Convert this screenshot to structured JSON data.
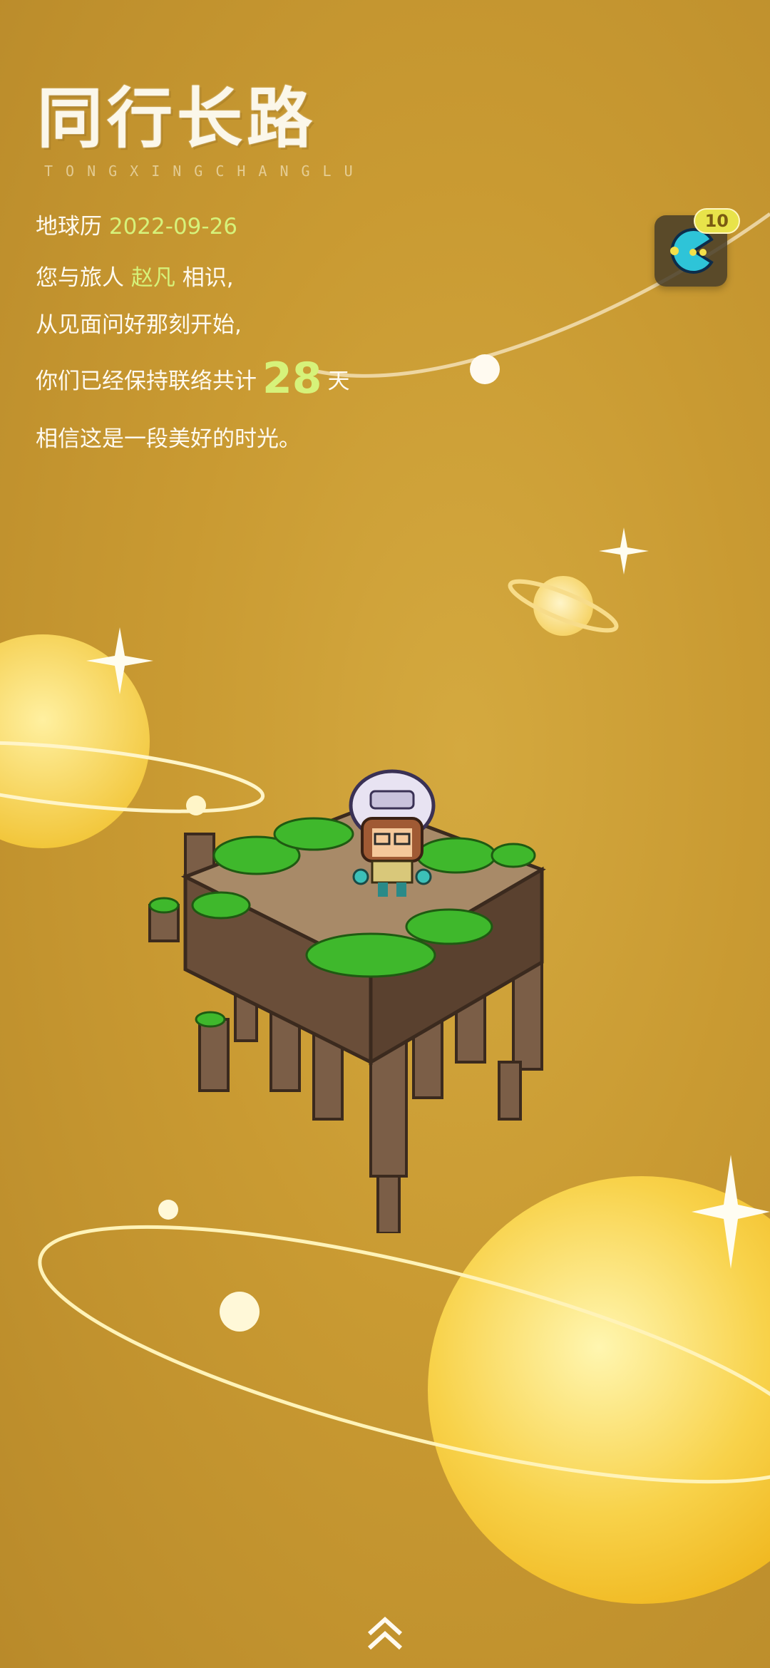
{
  "header": {
    "title": "同行长路",
    "subtitle": "TONGXINGCHANGLU"
  },
  "intro": {
    "date_label": "地球历",
    "date": "2022-09-26",
    "line2_prefix": "您与旅人",
    "traveler_name": "赵凡",
    "line2_suffix": "相识,",
    "line3": "从见面问好那刻开始,",
    "line4_prefix": "你们已经保持联络共计",
    "days": "28",
    "line4_suffix": "天",
    "line5": "相信这是一段美好的时光。"
  },
  "game_button": {
    "icon": "pacman-icon",
    "badge": "10"
  },
  "footer": {
    "scroll_icon": "double-chevron-up-icon"
  },
  "colors": {
    "background": "#c99a32",
    "highlight": "#d6f27a",
    "text": "#fffaf0"
  }
}
